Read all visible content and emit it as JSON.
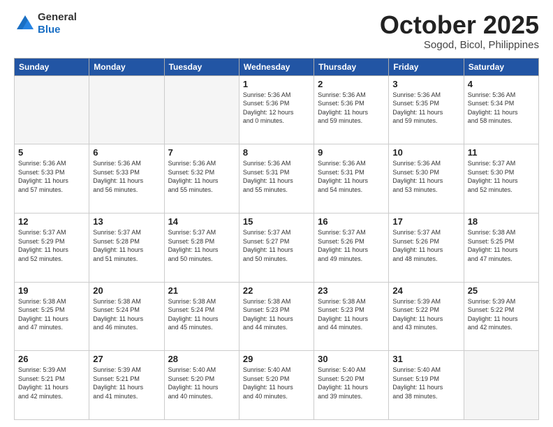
{
  "header": {
    "logo_general": "General",
    "logo_blue": "Blue",
    "title": "October 2025",
    "subtitle": "Sogod, Bicol, Philippines"
  },
  "weekdays": [
    "Sunday",
    "Monday",
    "Tuesday",
    "Wednesday",
    "Thursday",
    "Friday",
    "Saturday"
  ],
  "weeks": [
    [
      {
        "day": "",
        "info": ""
      },
      {
        "day": "",
        "info": ""
      },
      {
        "day": "",
        "info": ""
      },
      {
        "day": "1",
        "info": "Sunrise: 5:36 AM\nSunset: 5:36 PM\nDaylight: 12 hours\nand 0 minutes."
      },
      {
        "day": "2",
        "info": "Sunrise: 5:36 AM\nSunset: 5:36 PM\nDaylight: 11 hours\nand 59 minutes."
      },
      {
        "day": "3",
        "info": "Sunrise: 5:36 AM\nSunset: 5:35 PM\nDaylight: 11 hours\nand 59 minutes."
      },
      {
        "day": "4",
        "info": "Sunrise: 5:36 AM\nSunset: 5:34 PM\nDaylight: 11 hours\nand 58 minutes."
      }
    ],
    [
      {
        "day": "5",
        "info": "Sunrise: 5:36 AM\nSunset: 5:33 PM\nDaylight: 11 hours\nand 57 minutes."
      },
      {
        "day": "6",
        "info": "Sunrise: 5:36 AM\nSunset: 5:33 PM\nDaylight: 11 hours\nand 56 minutes."
      },
      {
        "day": "7",
        "info": "Sunrise: 5:36 AM\nSunset: 5:32 PM\nDaylight: 11 hours\nand 55 minutes."
      },
      {
        "day": "8",
        "info": "Sunrise: 5:36 AM\nSunset: 5:31 PM\nDaylight: 11 hours\nand 55 minutes."
      },
      {
        "day": "9",
        "info": "Sunrise: 5:36 AM\nSunset: 5:31 PM\nDaylight: 11 hours\nand 54 minutes."
      },
      {
        "day": "10",
        "info": "Sunrise: 5:36 AM\nSunset: 5:30 PM\nDaylight: 11 hours\nand 53 minutes."
      },
      {
        "day": "11",
        "info": "Sunrise: 5:37 AM\nSunset: 5:30 PM\nDaylight: 11 hours\nand 52 minutes."
      }
    ],
    [
      {
        "day": "12",
        "info": "Sunrise: 5:37 AM\nSunset: 5:29 PM\nDaylight: 11 hours\nand 52 minutes."
      },
      {
        "day": "13",
        "info": "Sunrise: 5:37 AM\nSunset: 5:28 PM\nDaylight: 11 hours\nand 51 minutes."
      },
      {
        "day": "14",
        "info": "Sunrise: 5:37 AM\nSunset: 5:28 PM\nDaylight: 11 hours\nand 50 minutes."
      },
      {
        "day": "15",
        "info": "Sunrise: 5:37 AM\nSunset: 5:27 PM\nDaylight: 11 hours\nand 50 minutes."
      },
      {
        "day": "16",
        "info": "Sunrise: 5:37 AM\nSunset: 5:26 PM\nDaylight: 11 hours\nand 49 minutes."
      },
      {
        "day": "17",
        "info": "Sunrise: 5:37 AM\nSunset: 5:26 PM\nDaylight: 11 hours\nand 48 minutes."
      },
      {
        "day": "18",
        "info": "Sunrise: 5:38 AM\nSunset: 5:25 PM\nDaylight: 11 hours\nand 47 minutes."
      }
    ],
    [
      {
        "day": "19",
        "info": "Sunrise: 5:38 AM\nSunset: 5:25 PM\nDaylight: 11 hours\nand 47 minutes."
      },
      {
        "day": "20",
        "info": "Sunrise: 5:38 AM\nSunset: 5:24 PM\nDaylight: 11 hours\nand 46 minutes."
      },
      {
        "day": "21",
        "info": "Sunrise: 5:38 AM\nSunset: 5:24 PM\nDaylight: 11 hours\nand 45 minutes."
      },
      {
        "day": "22",
        "info": "Sunrise: 5:38 AM\nSunset: 5:23 PM\nDaylight: 11 hours\nand 44 minutes."
      },
      {
        "day": "23",
        "info": "Sunrise: 5:38 AM\nSunset: 5:23 PM\nDaylight: 11 hours\nand 44 minutes."
      },
      {
        "day": "24",
        "info": "Sunrise: 5:39 AM\nSunset: 5:22 PM\nDaylight: 11 hours\nand 43 minutes."
      },
      {
        "day": "25",
        "info": "Sunrise: 5:39 AM\nSunset: 5:22 PM\nDaylight: 11 hours\nand 42 minutes."
      }
    ],
    [
      {
        "day": "26",
        "info": "Sunrise: 5:39 AM\nSunset: 5:21 PM\nDaylight: 11 hours\nand 42 minutes."
      },
      {
        "day": "27",
        "info": "Sunrise: 5:39 AM\nSunset: 5:21 PM\nDaylight: 11 hours\nand 41 minutes."
      },
      {
        "day": "28",
        "info": "Sunrise: 5:40 AM\nSunset: 5:20 PM\nDaylight: 11 hours\nand 40 minutes."
      },
      {
        "day": "29",
        "info": "Sunrise: 5:40 AM\nSunset: 5:20 PM\nDaylight: 11 hours\nand 40 minutes."
      },
      {
        "day": "30",
        "info": "Sunrise: 5:40 AM\nSunset: 5:20 PM\nDaylight: 11 hours\nand 39 minutes."
      },
      {
        "day": "31",
        "info": "Sunrise: 5:40 AM\nSunset: 5:19 PM\nDaylight: 11 hours\nand 38 minutes."
      },
      {
        "day": "",
        "info": ""
      }
    ]
  ]
}
